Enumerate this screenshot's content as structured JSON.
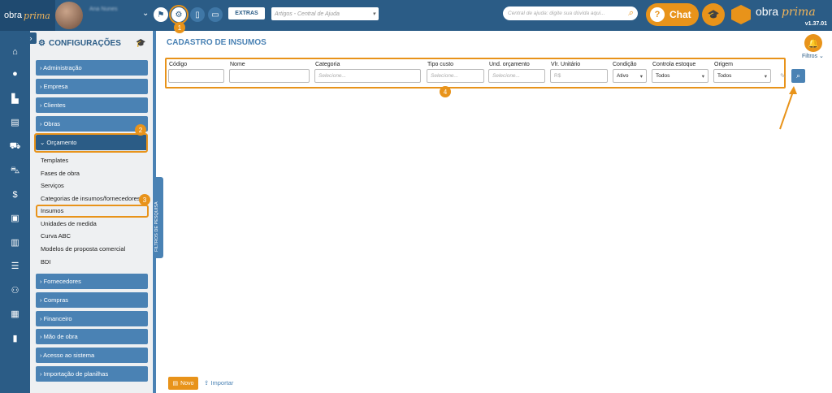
{
  "topbar": {
    "logo_main": "obra",
    "logo_italic": "prima",
    "user_name": "Ana Nunes",
    "extras_label": "EXTRAS",
    "articles_placeholder": "Artigos - Central de Ajuda",
    "help_search_placeholder": "Central de ajuda: digite sua dúvida aqui...",
    "chat_label": "Chat",
    "brand_main": "obra",
    "brand_italic": "prima",
    "version": "v1.37.01"
  },
  "panel": {
    "title": "CONFIGURAÇÕES",
    "menu": [
      {
        "label": "› Administração"
      },
      {
        "label": "› Empresa"
      },
      {
        "label": "› Clientes"
      },
      {
        "label": "› Obras"
      },
      {
        "label": "⌄ Orçamento"
      }
    ],
    "submenu": [
      "Templates",
      "Fases de obra",
      "Serviços",
      "Categorias de insumos/fornecedores",
      "Insumos",
      "Unidades de medida",
      "Curva ABC",
      "Modelos de proposta comercial",
      "BDI"
    ],
    "menu2": [
      {
        "label": "› Fornecedores"
      },
      {
        "label": "› Compras"
      },
      {
        "label": "› Financeiro"
      },
      {
        "label": "› Mão de obra"
      },
      {
        "label": "› Acesso ao sistema"
      },
      {
        "label": "› Importação de planilhas"
      }
    ],
    "side_tab": "FILTROS DE PESQUISA"
  },
  "main": {
    "title": "CADASTRO DE INSUMOS",
    "filters_label": "Filtros ⌄",
    "filters": {
      "codigo": {
        "label": "Código",
        "value": ""
      },
      "nome": {
        "label": "Nome",
        "value": ""
      },
      "categoria": {
        "label": "Categoria",
        "placeholder": "Selecione..."
      },
      "tipo_custo": {
        "label": "Tipo custo",
        "placeholder": "Selecione..."
      },
      "und_orcamento": {
        "label": "Und. orçamento",
        "placeholder": "Selecione..."
      },
      "vlr_unitario": {
        "label": "Vlr. Unitário",
        "placeholder": "R$"
      },
      "condicao": {
        "label": "Condição",
        "value": "Ativo"
      },
      "controla_estoque": {
        "label": "Controla estoque",
        "value": "Todos"
      },
      "origem": {
        "label": "Origem",
        "value": "Todos"
      }
    },
    "new_label": "Novo",
    "import_label": "Importar"
  },
  "annotations": {
    "b1": "1",
    "b2": "2",
    "b3": "3",
    "b4": "4"
  },
  "colors": {
    "primary": "#2b5c86",
    "menu": "#4a82b4",
    "accent": "#e8931a"
  }
}
